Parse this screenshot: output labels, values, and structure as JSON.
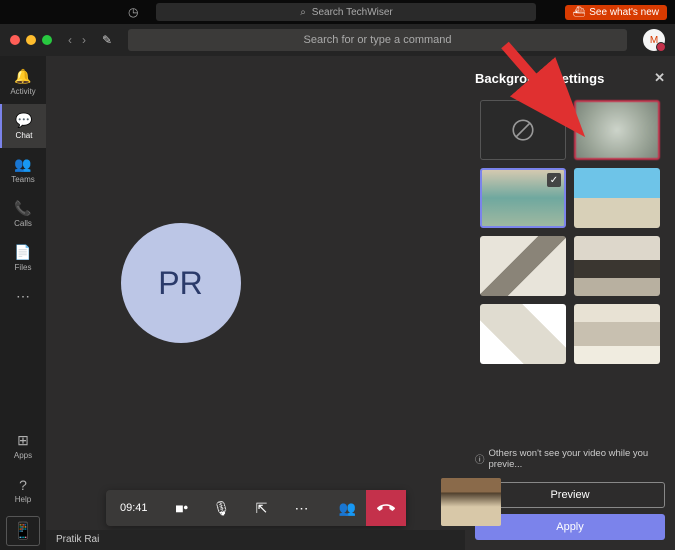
{
  "top": {
    "search_placeholder": "Search TechWiser",
    "whatsnew": "See what's new"
  },
  "titlebar": {
    "command_placeholder": "Search for or type a command",
    "avatar_initial": "M"
  },
  "rail": {
    "activity": "Activity",
    "chat": "Chat",
    "teams": "Teams",
    "calls": "Calls",
    "files": "Files",
    "apps": "Apps",
    "help": "Help"
  },
  "call": {
    "initials": "PR",
    "time": "09:41",
    "participant_name": "Pratik Rai"
  },
  "panel": {
    "title": "Background settings",
    "info": "Others won't see your video while you previe...",
    "preview": "Preview",
    "apply": "Apply"
  }
}
